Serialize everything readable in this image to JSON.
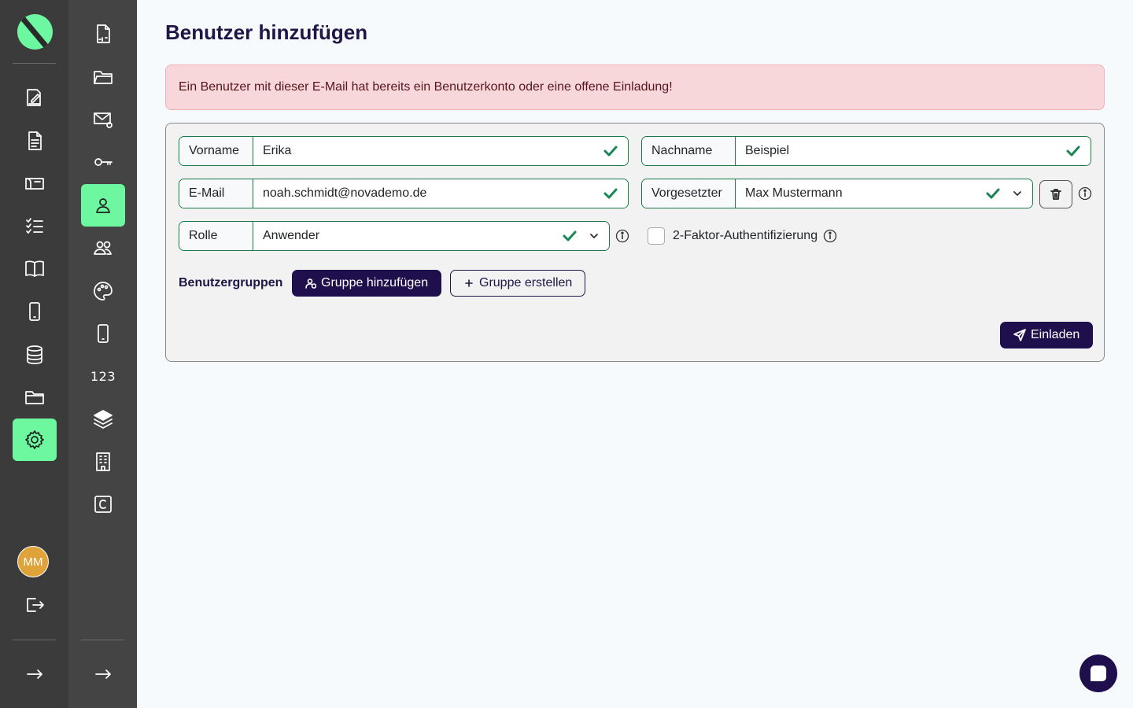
{
  "page": {
    "title": "Benutzer hinzufügen"
  },
  "alert": {
    "message": "Ein Benutzer mit dieser E-Mail hat bereits ein Benutzerkonto oder eine offene Einladung!"
  },
  "form": {
    "first_name": {
      "label": "Vorname",
      "value": "Erika"
    },
    "last_name": {
      "label": "Nachname",
      "value": "Beispiel"
    },
    "email": {
      "label": "E-Mail",
      "value": "noah.schmidt@novademo.de"
    },
    "supervisor": {
      "label": "Vorgesetzter",
      "value": "Max Mustermann"
    },
    "role": {
      "label": "Rolle",
      "value": "Anwender"
    },
    "two_factor": {
      "label": "2-Faktor-Authentifizierung",
      "checked": false
    },
    "groups_label": "Benutzergruppen",
    "add_group_label": "Gruppe hinzufügen",
    "create_group_label": "Gruppe erstellen",
    "invite_label": "Einladen"
  },
  "sidebar_primary": {
    "items": [
      "edit-document-icon",
      "document-icon",
      "inbox-icon",
      "checklist-icon",
      "book-icon",
      "phone-icon",
      "database-icon",
      "folder-icon",
      "settings-icon"
    ],
    "active": "settings-icon",
    "user_initials": "MM"
  },
  "sidebar_secondary": {
    "items": [
      "pdf-icon",
      "folder-icon",
      "mail-at-icon",
      "key-icon",
      "user-icon",
      "users-icon",
      "palette-icon",
      "phone-icon",
      "numbers-icon",
      "layers-icon",
      "building-icon",
      "c-box-icon"
    ],
    "active": "user-icon",
    "numbers_text": "123"
  },
  "colors": {
    "accent": "#6df79f",
    "primary": "#1f0f4d",
    "valid": "#198754",
    "alert_bg": "#f8d7da"
  }
}
